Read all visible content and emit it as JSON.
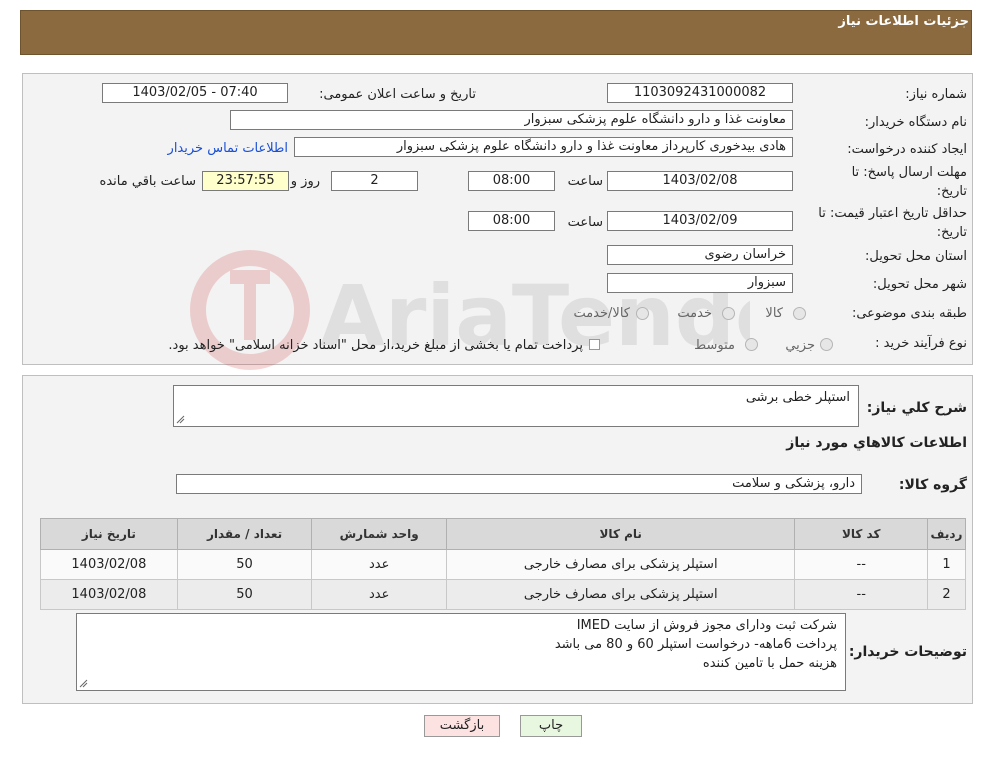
{
  "header": {
    "title": "جزئیات اطلاعات نیاز"
  },
  "form": {
    "need_number_label": "شماره نیاز:",
    "need_number": "1103092431000082",
    "announce_label": "تاریخ و ساعت اعلان عمومی:",
    "announce_value": "1403/02/05 - 07:40",
    "buyer_org_label": "نام دستگاه خریدار:",
    "buyer_org": "معاونت غذا و دارو   دانشگاه علوم پزشکی سبزوار",
    "creator_label": "ایجاد کننده درخواست:",
    "creator": "هادی بیدخوری کارپرداز معاونت غذا و دارو   دانشگاه علوم پزشکی سبزوار",
    "contact_link": "اطلاعات تماس خریدار",
    "deadline_label_1": "مهلت ارسال پاسخ: تا",
    "deadline_label_2": "تاریخ:",
    "deadline_date": "1403/02/08",
    "time_label": "ساعت",
    "deadline_time": "08:00",
    "days_value": "2",
    "days_label": "روز و",
    "remaining_time": "23:57:55",
    "remaining_label": "ساعت باقي مانده",
    "validity_label_1": "حداقل تاریخ اعتبار قیمت: تا",
    "validity_label_2": "تاریخ:",
    "validity_date": "1403/02/09",
    "validity_time": "08:00",
    "province_label": "استان محل تحویل:",
    "province": "خراسان رضوی",
    "city_label": "شهر محل تحویل:",
    "city": "سبزوار",
    "category_label": "طبقه بندی موضوعی:",
    "category_options": [
      "کالا",
      "خدمت",
      "کالا/خدمت"
    ],
    "process_label": "نوع فرآیند خرید :",
    "process_options": [
      "جزیي",
      "متوسط"
    ],
    "process_note": "پرداخت تمام یا بخشی از مبلغ خرید،از محل \"اسناد خزانه اسلامی\" خواهد بود."
  },
  "details": {
    "summary_label": "شرح کلي نیاز:",
    "summary": "استپلر خطی برشی",
    "goods_info_title": "اطلاعات کالاهاي مورد نیاز",
    "goods_group_label": "گروه کالا:",
    "goods_group": "دارو، پزشکی و سلامت",
    "table": {
      "headers": [
        "ردیف",
        "کد کالا",
        "نام کالا",
        "واحد شمارش",
        "تعداد / مقدار",
        "تاریخ نیاز"
      ],
      "rows": [
        [
          "1",
          "--",
          "استپلر پزشکی برای مصارف خارجی",
          "عدد",
          "50",
          "1403/02/08"
        ],
        [
          "2",
          "--",
          "استپلر پزشکی برای مصارف خارجی",
          "عدد",
          "50",
          "1403/02/08"
        ]
      ]
    },
    "buyer_notes_label": "توضیحات خریدار:",
    "buyer_notes": [
      "شرکت ثبت ودارای مجوز فروش از سایت IMED",
      "پرداخت 6ماهه- درخواست استپلر 60 و 80 می باشد",
      "هزینه حمل با تامین کننده"
    ]
  },
  "buttons": {
    "print": "چاپ",
    "back": "بازگشت"
  },
  "colors": {
    "header_bg": "#8b6a3f",
    "back_button_bg": "#fde2e2",
    "print_button_bg": "#e8f8e0"
  }
}
